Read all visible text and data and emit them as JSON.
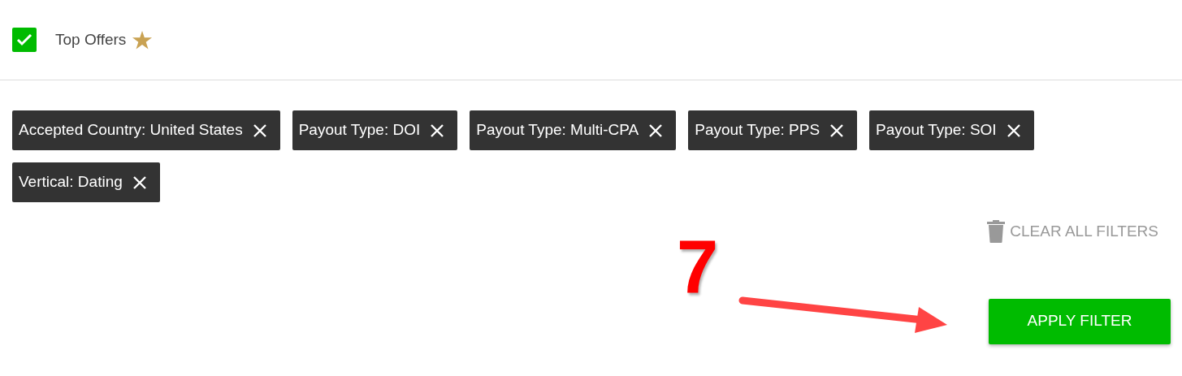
{
  "top_offers": {
    "label": "Top Offers",
    "checked": true
  },
  "filter_chips": [
    {
      "label": "Accepted Country: United States"
    },
    {
      "label": "Payout Type: DOI"
    },
    {
      "label": "Payout Type: Multi-CPA"
    },
    {
      "label": "Payout Type: PPS"
    },
    {
      "label": "Payout Type: SOI"
    },
    {
      "label": "Vertical: Dating"
    }
  ],
  "clear_all": {
    "label": "CLEAR ALL FILTERS"
  },
  "apply_button": {
    "label": "APPLY FILTER"
  },
  "annotation": {
    "step": "7"
  }
}
